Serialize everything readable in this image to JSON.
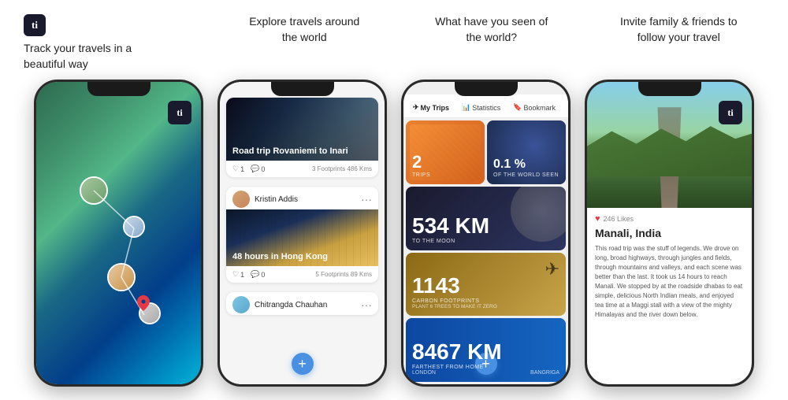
{
  "app": {
    "logo_text": "ti",
    "logo_text2": "ti"
  },
  "columns": [
    {
      "id": "track",
      "title_line1": "Track your travels in a",
      "title_line2": "beautiful way"
    },
    {
      "id": "explore",
      "title_line1": "Explore travels around",
      "title_line2": "the world"
    },
    {
      "id": "seen",
      "title_line1": "What have you seen of",
      "title_line2": "the world?"
    },
    {
      "id": "invite",
      "title_line1": "Invite family & friends to",
      "title_line2": "follow your travel"
    }
  ],
  "phone2": {
    "card1_title": "Road trip Rovaniemi to Inari",
    "card1_likes": "1",
    "card1_comments": "0",
    "card1_footprints": "3 Footprints  486 Kms",
    "card2_user": "Kristin Addis",
    "card2_title": "48 hours in Hong Kong",
    "card2_likes": "1",
    "card2_comments": "0",
    "card2_footprints": "5 Footprints  89 Kms",
    "card3_user": "Chitrangda Chauhan",
    "plus": "+"
  },
  "phone3": {
    "tab1": "My Trips",
    "tab2": "Statistics",
    "tab3": "Bookmark",
    "trips_count": "2",
    "trips_label": "TRIPS",
    "world_pct": "0.1 %",
    "world_label": "OF THE WORLD SEEN",
    "km_number": "534 KM",
    "km_label": "TO THE MOON",
    "footprints_number": "1143",
    "footprints_label": "CARBON FOOTPRINTS",
    "footprints_sublabel": "PLANT 6 TREES TO MAKE IT ZERO",
    "farthest_number": "8467 KM",
    "farthest_label": "FARTHEST FROM HOME",
    "farthest_loc1": "LONDON",
    "farthest_loc2": "BANGRIGA",
    "plus": "+"
  },
  "phone4": {
    "likes": "246 Likes",
    "title": "Manali, India",
    "text": "This road trip was the stuff of legends. We drove on long, broad highways, through jungles and fields, through mountains and valleys, and each scene was better than the last. It took us 14 hours to reach Manali. We stopped by at the roadside dhabas to eat simple, delicious North Indian meals, and enjoyed tea time at a Maggi stall with a view of the mighty Himalayas and the river down below."
  }
}
